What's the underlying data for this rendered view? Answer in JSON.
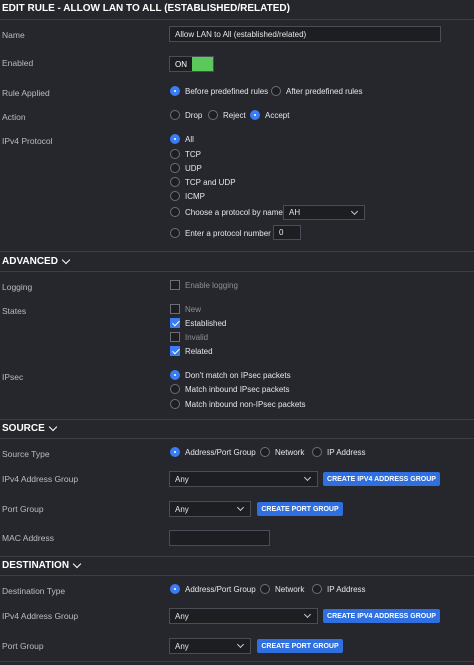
{
  "title": "EDIT RULE - ALLOW LAN TO ALL (ESTABLISHED/RELATED)",
  "name": {
    "label": "Name",
    "value": "Allow LAN to All (established/related)"
  },
  "enabled": {
    "label": "Enabled",
    "state": "ON"
  },
  "rule_applied": {
    "label": "Rule Applied",
    "options": [
      "Before predefined rules",
      "After predefined rules"
    ],
    "selected": 0
  },
  "action": {
    "label": "Action",
    "options": [
      "Drop",
      "Reject",
      "Accept"
    ],
    "selected": 2
  },
  "ipv4_protocol": {
    "label": "IPv4 Protocol",
    "options": [
      "All",
      "TCP",
      "UDP",
      "TCP and UDP",
      "ICMP",
      "Choose a protocol by name",
      "Enter a protocol number"
    ],
    "selected": 0,
    "protocol_name_value": "AH",
    "protocol_number_value": "0"
  },
  "advanced": {
    "header": "ADVANCED",
    "logging": {
      "label": "Logging",
      "option": "Enable logging",
      "checked": false
    },
    "states": {
      "label": "States",
      "options": [
        {
          "text": "New",
          "checked": false
        },
        {
          "text": "Established",
          "checked": true
        },
        {
          "text": "Invalid",
          "checked": false
        },
        {
          "text": "Related",
          "checked": true
        }
      ]
    },
    "ipsec": {
      "label": "IPsec",
      "options": [
        "Don't match on IPsec packets",
        "Match inbound IPsec packets",
        "Match inbound non-IPsec packets"
      ],
      "selected": 0
    }
  },
  "source": {
    "header": "SOURCE",
    "source_type": {
      "label": "Source Type",
      "options": [
        "Address/Port Group",
        "Network",
        "IP Address"
      ],
      "selected": 0
    },
    "ipv4_address_group": {
      "label": "IPv4 Address Group",
      "value": "Any",
      "button": "CREATE IPV4 ADDRESS GROUP"
    },
    "port_group": {
      "label": "Port Group",
      "value": "Any",
      "button": "CREATE PORT GROUP"
    },
    "mac_address": {
      "label": "MAC Address",
      "value": ""
    }
  },
  "destination": {
    "header": "DESTINATION",
    "destination_type": {
      "label": "Destination Type",
      "options": [
        "Address/Port Group",
        "Network",
        "IP Address"
      ],
      "selected": 0
    },
    "ipv4_address_group": {
      "label": "IPv4 Address Group",
      "value": "Any",
      "button": "CREATE IPV4 ADDRESS GROUP"
    },
    "port_group": {
      "label": "Port Group",
      "value": "Any",
      "button": "CREATE PORT GROUP"
    }
  },
  "colors": {
    "background": "#25272c",
    "accent": "#3a7cf5",
    "toggle_on": "#5ac85a",
    "button": "#2f6fe0"
  }
}
